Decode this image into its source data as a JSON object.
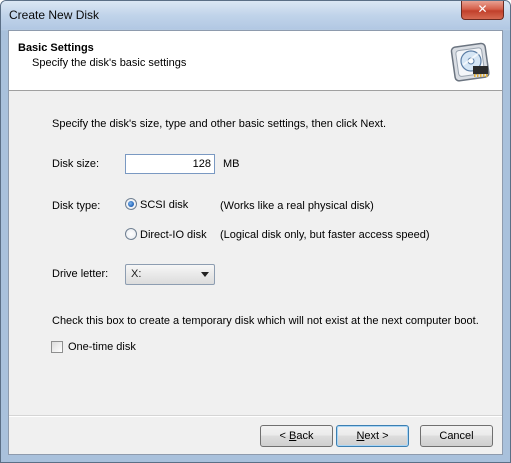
{
  "window": {
    "title": "Create New Disk",
    "close_glyph": "✕"
  },
  "header": {
    "title": "Basic Settings",
    "subtitle": "Specify the disk's basic settings",
    "logo_icon": "disk-cd-chip-icon"
  },
  "intro": "Specify the disk's size, type and other basic settings, then click Next.",
  "disk_size": {
    "label": "Disk size:",
    "value": "128",
    "unit": "MB"
  },
  "disk_type": {
    "label": "Disk type:",
    "options": [
      {
        "label": "SCSI disk",
        "description": "(Works like a real physical disk)",
        "checked": true
      },
      {
        "label": "Direct-IO disk",
        "description": "(Logical disk only, but faster access speed)",
        "checked": false
      }
    ]
  },
  "drive_letter": {
    "label": "Drive letter:",
    "value": "X:"
  },
  "temp_disk": {
    "description": "Check this box to create a temporary disk which will not exist at the next computer boot.",
    "label": "One-time disk",
    "checked": false
  },
  "buttons": {
    "back": {
      "prefix": "< ",
      "accel": "B",
      "rest": "ack"
    },
    "next": {
      "accel": "N",
      "rest": "ext >"
    },
    "cancel": "Cancel"
  }
}
